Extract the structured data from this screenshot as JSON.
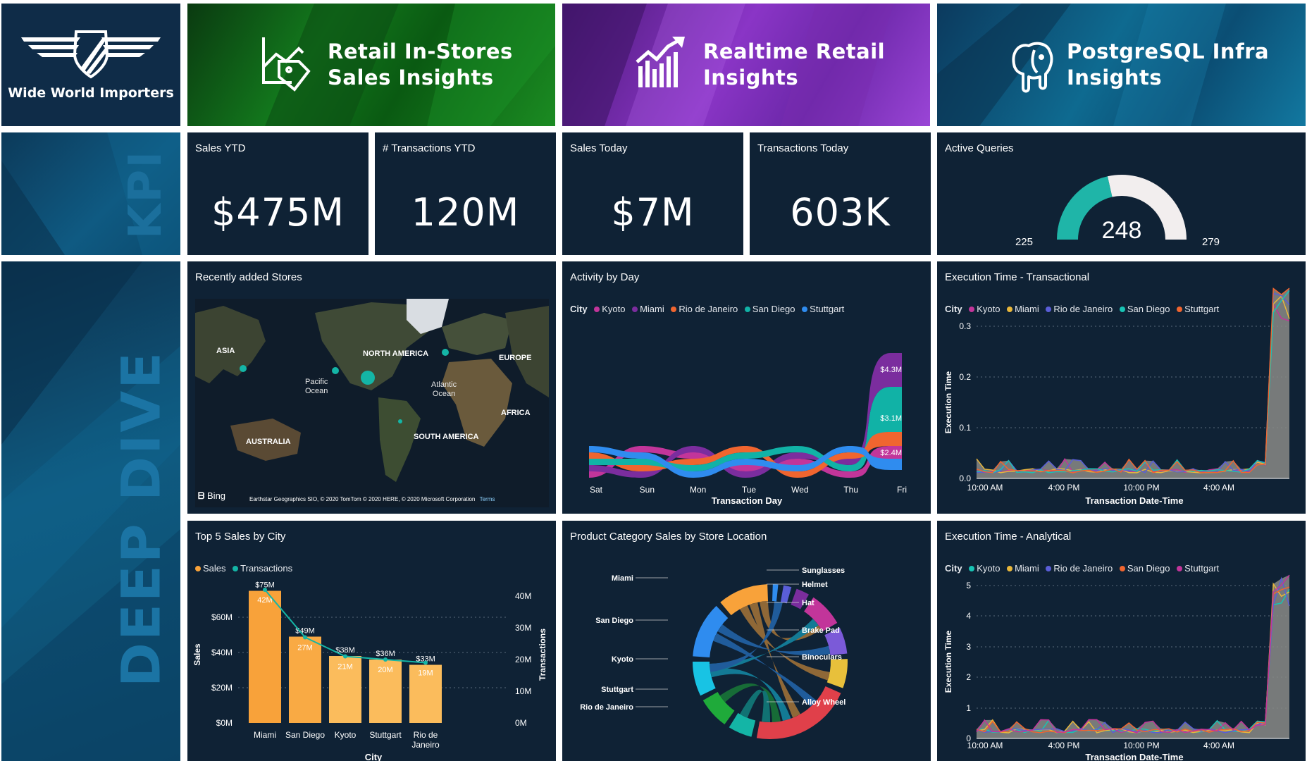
{
  "brand": {
    "name": "Wide World Importers"
  },
  "banners": [
    {
      "title_line1": "Retail In-Stores",
      "title_line2": "Sales Insights",
      "icon": "store-tag-icon"
    },
    {
      "title_line1": "Realtime Retail",
      "title_line2": "Insights",
      "icon": "growth-chart-icon"
    },
    {
      "title_line1": "PostgreSQL Infra",
      "title_line2": "Insights",
      "icon": "postgresql-elephant-icon"
    }
  ],
  "side_labels": {
    "kpi": "KPI",
    "deep_dive": "DEEP DIVE"
  },
  "kpis": [
    {
      "title": "Sales YTD",
      "value": "$475M"
    },
    {
      "title": "# Transactions YTD",
      "value": "120M"
    },
    {
      "title": "Sales Today",
      "value": "$7M"
    },
    {
      "title": "Transactions Today",
      "value": "603K"
    }
  ],
  "gauge": {
    "title": "Active Queries",
    "value": "248",
    "min": "225",
    "max": "279",
    "fraction": 0.43,
    "fill_color": "#1fb5a8",
    "track_color": "#f2eeee"
  },
  "map_tile": {
    "title": "Recently added Stores",
    "labels": {
      "asia": "ASIA",
      "north_america": "NORTH AMERICA",
      "europe": "EUROPE",
      "pacific": "Pacific\nOcean",
      "atlantic": "Atlantic\nOcean",
      "africa": "AFRICA",
      "south_america": "SOUTH AMERICA",
      "australia": "AUSTRALIA"
    },
    "bing": "Bing",
    "attribution": "Earthstar Geographics SIO, © 2020 TomTom © 2020 HERE, © 2020 Microsoft Corporation",
    "terms": "Terms"
  },
  "activity": {
    "title": "Activity by Day",
    "legend_label": "City",
    "legend": [
      {
        "name": "Kyoto",
        "color": "#c2359a"
      },
      {
        "name": "Miami",
        "color": "#7b2d9e"
      },
      {
        "name": "Rio de Janeiro",
        "color": "#f0652f"
      },
      {
        "name": "San Diego",
        "color": "#11b2a6"
      },
      {
        "name": "Stuttgart",
        "color": "#2f8cef"
      }
    ],
    "xlabel": "Transaction Day",
    "days": [
      "Sat",
      "Sun",
      "Mon",
      "Tue",
      "Wed",
      "Thu",
      "Fri"
    ],
    "data_labels": [
      "$4.3M",
      "$3.1M",
      "$2.4M"
    ]
  },
  "exec_trans": {
    "title": "Execution Time - Transactional",
    "legend_label": "City",
    "legend": [
      {
        "name": "Kyoto",
        "color": "#c2359a"
      },
      {
        "name": "Miami",
        "color": "#e8b73b"
      },
      {
        "name": "Rio de Janeiro",
        "color": "#5a5ed8"
      },
      {
        "name": "San Diego",
        "color": "#18c3b4"
      },
      {
        "name": "Stuttgart",
        "color": "#f0652f"
      }
    ],
    "ylabel": "Execution Time",
    "xlabel": "Transaction Date-Time",
    "yticks": [
      "0.0",
      "0.1",
      "0.2",
      "0.3"
    ],
    "xticks": [
      "10:00 AM",
      "4:00 PM",
      "10:00 PM",
      "4:00 AM"
    ]
  },
  "top5": {
    "title": "Top 5 Sales by City",
    "legend": [
      {
        "name": "Sales",
        "color": "#f8a23a"
      },
      {
        "name": "Transactions",
        "color": "#14b5a6"
      }
    ],
    "ylabel": "Sales",
    "y2label": "Transactions",
    "xlabel": "City",
    "yticks": [
      "$0M",
      "$20M",
      "$40M",
      "$60M"
    ],
    "y2ticks": [
      "0M",
      "10M",
      "20M",
      "30M",
      "40M"
    ]
  },
  "chord": {
    "title": "Product Category Sales by Store Location",
    "left_labels": [
      "Miami",
      "San Diego",
      "Kyoto",
      "Stuttgart",
      "Rio de Janeiro"
    ],
    "right_labels": [
      "Sunglasses",
      "Helmet",
      "Hat",
      "Brake Pad",
      "Binoculars",
      "Alloy Wheel"
    ]
  },
  "exec_anal": {
    "title": "Execution Time - Analytical",
    "legend_label": "City",
    "legend": [
      {
        "name": "Kyoto",
        "color": "#18c3b4"
      },
      {
        "name": "Miami",
        "color": "#e8b73b"
      },
      {
        "name": "Rio de Janeiro",
        "color": "#5a5ed8"
      },
      {
        "name": "San Diego",
        "color": "#f0652f"
      },
      {
        "name": "Stuttgart",
        "color": "#c2359a"
      }
    ],
    "ylabel": "Execution Time",
    "xlabel": "Transaction Date-Time",
    "yticks": [
      "0",
      "1",
      "2",
      "3",
      "4",
      "5"
    ],
    "xticks": [
      "10:00 AM",
      "4:00 PM",
      "10:00 PM",
      "4:00 AM"
    ]
  },
  "chart_data": {
    "type": "bar",
    "title": "Top 5 Sales by City",
    "categories": [
      "Miami",
      "San Diego",
      "Kyoto",
      "Stuttgart",
      "Rio de\nJaneiro"
    ],
    "series": [
      {
        "name": "Sales",
        "values": [
          75,
          49,
          38,
          36,
          33
        ],
        "labels": [
          "$75M",
          "$49M",
          "$38M",
          "$36M",
          "$33M"
        ]
      },
      {
        "name": "Transactions",
        "values": [
          42,
          27,
          21,
          20,
          19
        ],
        "labels": [
          "42M",
          "27M",
          "21M",
          "20M",
          "19M"
        ]
      }
    ],
    "xlabel": "City",
    "ylabel": "Sales",
    "y2label": "Transactions",
    "ylim": [
      0,
      80
    ],
    "y2lim": [
      0,
      45
    ]
  }
}
